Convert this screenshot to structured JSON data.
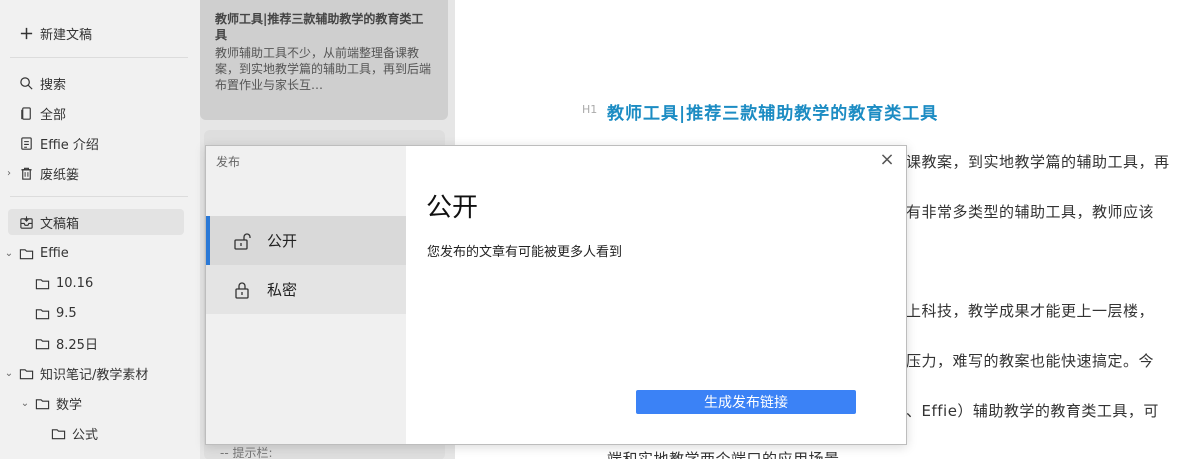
{
  "sidebar": {
    "new_doc": "新建文稿",
    "search": "搜索",
    "all": "全部",
    "effie_intro": "Effie 介绍",
    "trash": "废纸篓",
    "drafts": "文稿箱",
    "effie": "Effie",
    "folder_1016": "10.16",
    "folder_95": "9.5",
    "folder_825": "8.25日",
    "knowledge": "知识笔记/教学素材",
    "math": "数学",
    "formula": "公式"
  },
  "notelist": {
    "card_title": "教师工具|推荐三款辅助教学的教育类工具",
    "card_excerpt": "教师辅助工具不少，从前端整理备课教案，到实地教学篇的辅助工具，再到后端布置作业与家长互…",
    "tip": "-- 提示栏:"
  },
  "editor": {
    "h1_marker": "H1",
    "title": "教师工具|推荐三款辅助教学的教育类工具",
    "lines": [
      "课教案，到实地教学篇的辅助工具，再",
      "有非常多类型的辅助工具，教师应该",
      "上科技，教学成果才能更上一层楼，",
      "压力，难写的教案也能快速搞定。今",
      "、Effie）辅助教学的教育类工具，可",
      "端和实地教学两个端口的应用场景"
    ]
  },
  "dialog": {
    "header": "发布",
    "options": [
      {
        "label": "公开",
        "icon": "unlock-icon"
      },
      {
        "label": "私密",
        "icon": "lock-icon"
      }
    ],
    "title": "公开",
    "description": "您发布的文章有可能被更多人看到",
    "close": "×",
    "button": "生成发布链接"
  },
  "colors": {
    "accent": "#3b82f6",
    "selected_bar": "#2b79d6",
    "title_blue": "#1c8cc3"
  }
}
